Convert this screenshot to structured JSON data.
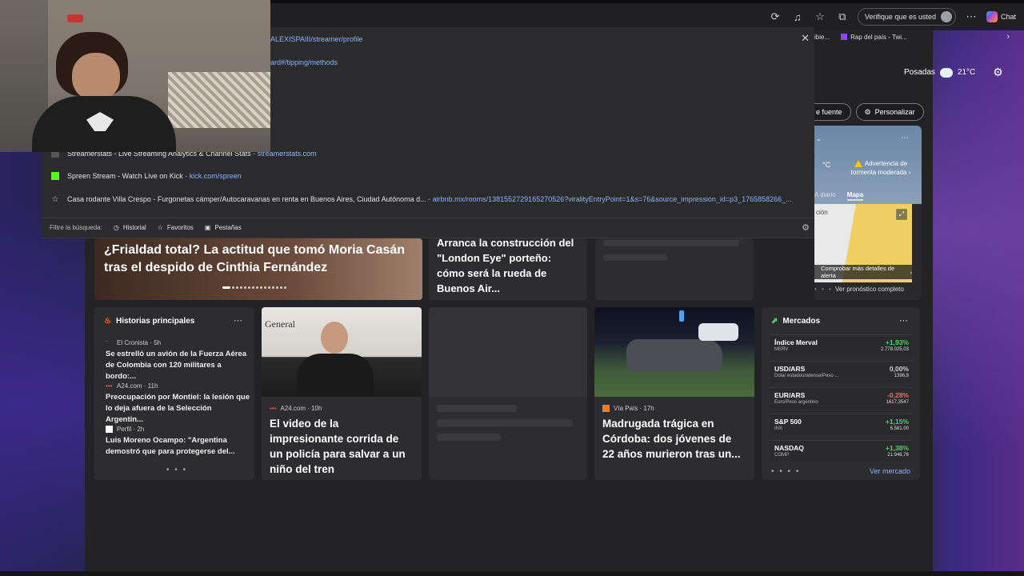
{
  "toolbar": {
    "verify_label": "Verifique que es usted",
    "chat_label": "Chat"
  },
  "bookmarks": [
    {
      "label": "ibie..."
    },
    {
      "label": "Rap del país - Twi..."
    }
  ],
  "dropdown": {
    "suggestions": [
      {
        "title": "",
        "url": "ALEXISPAIII/streamer/profile"
      },
      {
        "title": "",
        "url": "ard#/tipping/methods"
      },
      {
        "title": "Streamerstats - Live Streaming Analytics & Channel Stats",
        "url": "streamerstats.com"
      },
      {
        "title": "Spreen Stream - Watch Live on Kick",
        "url": "kick.com/spreen"
      },
      {
        "title": "Casa rodante Villa Crespo - Furgonetas cámper/Autocaravanas en renta en Buenos Aires, Ciudad Autónoma d...",
        "url": "airbnb.mx/rooms/1381552729165270526?viralityEntryPoint=1&s=76&source_impression_id=p3_1765858266_..."
      }
    ],
    "filter_label": "Filtre la búsqueda:",
    "filters": [
      "Historial",
      "Favoritos",
      "Pestañas"
    ]
  },
  "weather_header": {
    "city": "Posadas",
    "temp": "21°C"
  },
  "personalize": {
    "source_label": "e fuente",
    "personalize_label": "Personalizar"
  },
  "weather_card": {
    "unit": "°C",
    "alert": "Advertencia de tormenta moderada",
    "tab_daily": "A diario",
    "tab_map": "Mapa",
    "map_label": "ción",
    "alert_link": "Comprobar más detalles de alerta",
    "forecast_link": "Ver pronóstico completo"
  },
  "hero": {
    "title": "¿Frialdad total? La actitud que tomó Moria Casán tras el despido de Cinthia Fernández"
  },
  "card_b": {
    "title": "Arranca la construcción del \"London Eye\" porteño: cómo será la rueda de Buenos Air..."
  },
  "top_stories": {
    "heading": "Historias principales",
    "items": [
      {
        "source": "El Cronista · 5h",
        "text": "Se estrelló un avión de la Fuerza Aérea de Colombia con 120 militares a bordo:..."
      },
      {
        "source": "A24.com · 11h",
        "text": "Preocupación por Montiel: la lesión que lo deja afuera de la Selección Argentin..."
      },
      {
        "source": "Perfil · 2h",
        "text": "Luis Moreno Ocampo: \"Argentina demostró que para protegerse del..."
      }
    ]
  },
  "news_police": {
    "source": "A24.com · 10h",
    "title": "El video de la impresionante corrida de un policía para salvar a un niño del tren",
    "img_text": "General"
  },
  "news_crash": {
    "source": "Vía País · 17h",
    "title": "Madrugada trágica en Córdoba: dos jóvenes de 22 años murieron tras un..."
  },
  "markets": {
    "heading": "Mercados",
    "rows": [
      {
        "name": "Índice Merval",
        "sub": "MERV",
        "change": "+1,93%",
        "price": "2.778.025,03",
        "dir": "up"
      },
      {
        "name": "USD/ARS",
        "sub": "Dólar estadounidense/Peso ...",
        "change": "0,00%",
        "price": "1396,8",
        "dir": "flat"
      },
      {
        "name": "EUR/ARS",
        "sub": "Euro/Peso argentino",
        "change": "-0,28%",
        "price": "1617,3547",
        "dir": "down"
      },
      {
        "name": "S&P 500",
        "sub": "INX",
        "change": "+1,15%",
        "price": "6.581,00",
        "dir": "up"
      },
      {
        "name": "NASDAQ",
        "sub": "COMP",
        "change": "+1,38%",
        "price": "21.946,76",
        "dir": "up"
      }
    ],
    "link": "Ver mercado"
  },
  "colors": {
    "link": "#8ab4f8",
    "up": "#4fd16a",
    "down": "#f26b6b"
  }
}
